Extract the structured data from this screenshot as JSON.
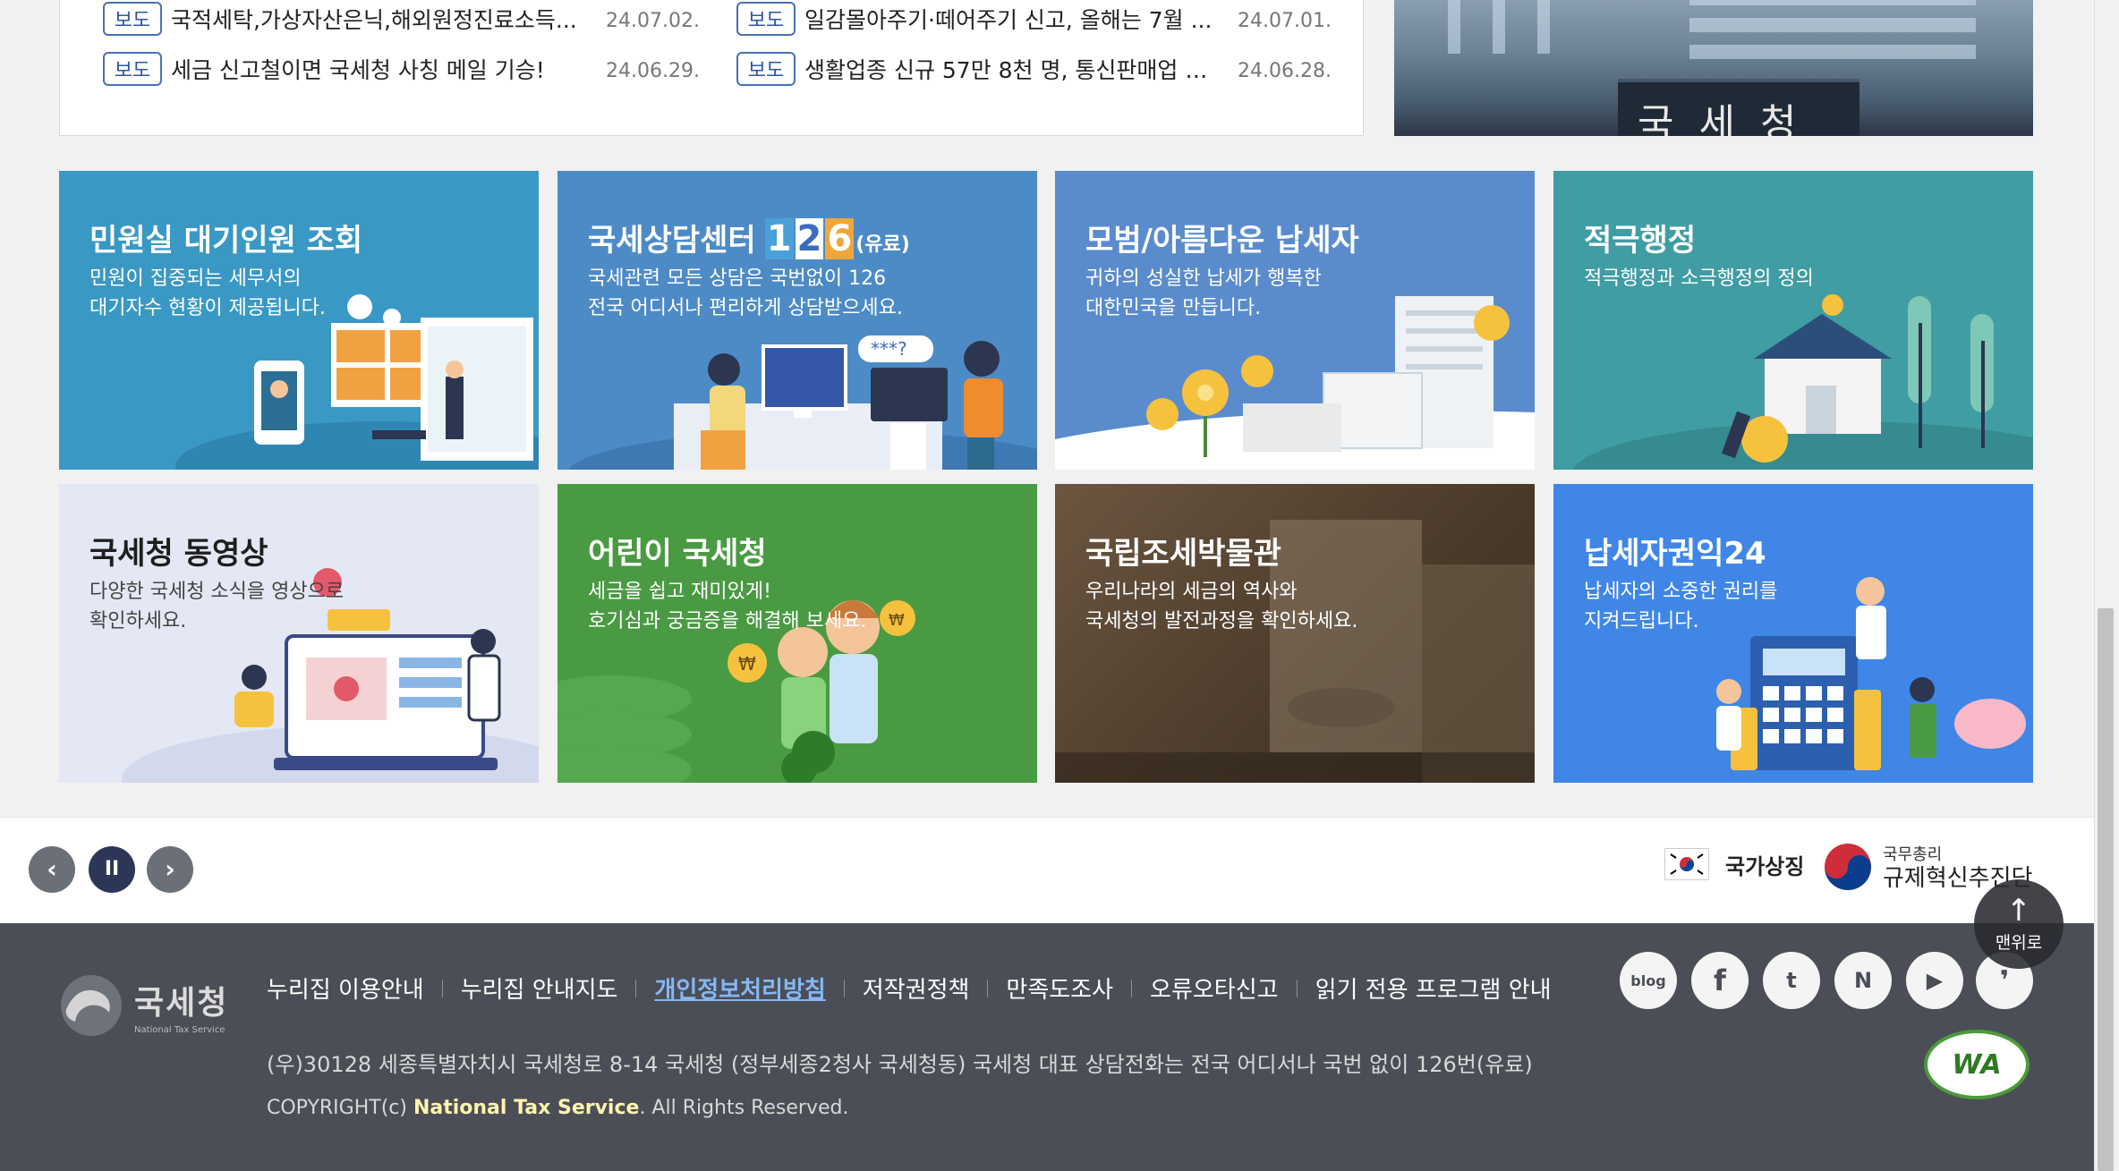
{
  "news": {
    "badge": "보도",
    "items": [
      {
        "title": "국적세탁,가상자산은닉,해외원정진료소득...",
        "date": "24.07.02."
      },
      {
        "title": "일감몰아주기·떼어주기 신고, 올해는 7월 ...",
        "date": "24.07.01."
      },
      {
        "title": "세금 신고철이면 국세청 사칭 메일 기승!",
        "date": "24.06.29."
      },
      {
        "title": "생활업종 신규 57만 8천 명, 통신판매업 5...",
        "date": "24.06.28."
      }
    ]
  },
  "building_sign": "국세청",
  "tiles": [
    {
      "title": "민원실 대기인원 조회",
      "desc": "민원이 집중되는 세무서의\n대기자수 현황이 제공됩니다.",
      "color": "#3a98c4"
    },
    {
      "title": "국세상담센터",
      "hl": [
        "1",
        "2",
        "6"
      ],
      "paid": "(유료)",
      "desc": "국세관련 모든 상담은 국번없이 126\n전국 어디서나 편리하게 상담받으세요.",
      "color": "#4d8bc6"
    },
    {
      "title": "모범/아름다운 납세자",
      "desc": "귀하의 성실한 납세가 행복한\n대한민국을 만듭니다.",
      "color": "#5a8ccd"
    },
    {
      "title": "적극행정",
      "desc": "적극행정과 소극행정의 정의",
      "color": "#3f9da3"
    },
    {
      "title": "국세청 동영상",
      "desc": "다양한 국세청 소식을 영상으로\n확인하세요.",
      "color": "#e4e8f4"
    },
    {
      "title": "어린이 국세청",
      "desc": "세금을 쉽고 재미있게!\n호기심과 궁금증을 해결해 보세요.",
      "color": "#4a9a43"
    },
    {
      "title": "국립조세박물관",
      "desc": "우리나라의 세금의 역사와\n국세청의 발전과정을 확인하세요.",
      "color": "#5e4a35"
    },
    {
      "title": "납세자권익24",
      "desc": "납세자의 소중한 권리를\n지켜드립니다.",
      "color": "#3f86e6"
    }
  ],
  "controls": {
    "prev": "‹",
    "pause": "II",
    "next": "›"
  },
  "national_symbol": "국가상징",
  "gov": {
    "small": "국무총리",
    "big": "규제혁신추진단"
  },
  "top_button": {
    "arrow": "↑",
    "label": "맨위로"
  },
  "footer": {
    "logo_ko": "국세청",
    "logo_en": "National Tax Service",
    "links": [
      "누리집 이용안내",
      "누리집 안내지도",
      "개인정보처리방침",
      "저작권정책",
      "만족도조사",
      "오류오타신고",
      "읽기 전용 프로그램 안내"
    ],
    "address": "(우)30128 세종특별자치시 국세청로 8-14 국세청 (정부세종2청사 국세청동) 국세청 대표 상담전화는 전국 어디서나 국번 없이 126번(유료)",
    "copyright_prefix": "COPYRIGHT(c) ",
    "copyright_org": "National Tax Service",
    "copyright_suffix": ". All Rights Reserved.",
    "sns": [
      "blog",
      "f",
      "t",
      "N",
      "▶",
      "❜"
    ],
    "wa_mark": "WA"
  }
}
